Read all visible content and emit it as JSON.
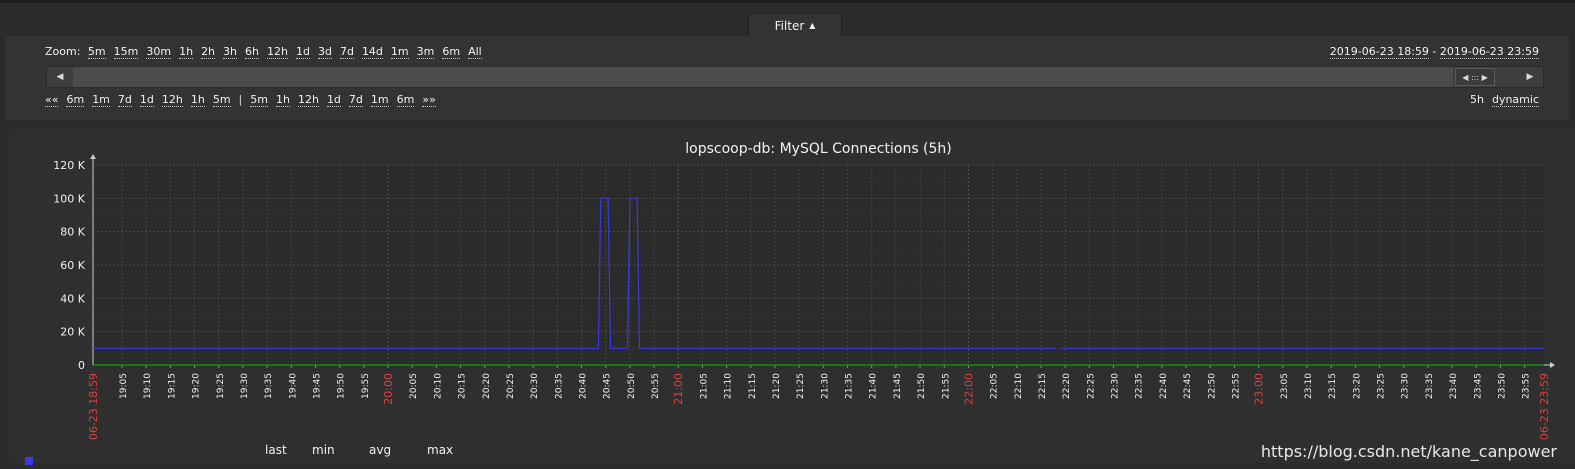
{
  "filter": {
    "label": "Filter",
    "arrow": "▲"
  },
  "zoom": {
    "label": "Zoom:",
    "options": [
      "5m",
      "15m",
      "30m",
      "1h",
      "2h",
      "3h",
      "6h",
      "12h",
      "1d",
      "3d",
      "7d",
      "14d",
      "1m",
      "3m",
      "6m",
      "All"
    ]
  },
  "range": {
    "from": "2019-06-23 18:59",
    "dash": " - ",
    "to": "2019-06-23 23:59"
  },
  "nav": {
    "back_all": "««",
    "back": [
      "6m",
      "1m",
      "7d",
      "1d",
      "12h",
      "1h",
      "5m"
    ],
    "sep": "|",
    "forward": [
      "5m",
      "1h",
      "12h",
      "1d",
      "7d",
      "1m",
      "6m"
    ],
    "forward_all": "»»"
  },
  "period": {
    "length": "5h",
    "mode": "dynamic"
  },
  "slider": {
    "left_icon": "◀",
    "right_icon": "▶",
    "handle": "◀ ::: ▶"
  },
  "chart_data": {
    "type": "line",
    "title": "lopscoop-db: MySQL Connections (5h)",
    "y_ticks": [
      "120 K",
      "100 K",
      "80 K",
      "60 K",
      "40 K",
      "20 K",
      "0"
    ],
    "ylim": [
      0,
      120000
    ],
    "x_start_label": "06-23 18:59",
    "x_end_label": "06-23 23:59",
    "x_ticks": [
      "19:05",
      "19:10",
      "19:15",
      "19:20",
      "19:25",
      "19:30",
      "19:35",
      "19:40",
      "19:45",
      "19:50",
      "19:55",
      "20:00",
      "20:05",
      "20:10",
      "20:15",
      "20:20",
      "20:25",
      "20:30",
      "20:35",
      "20:40",
      "20:45",
      "20:50",
      "20:55",
      "21:00",
      "21:05",
      "21:10",
      "21:15",
      "21:20",
      "21:25",
      "21:30",
      "21:35",
      "21:40",
      "21:45",
      "21:50",
      "21:55",
      "22:00",
      "22:05",
      "22:10",
      "22:15",
      "22:20",
      "22:25",
      "22:30",
      "22:35",
      "22:40",
      "22:45",
      "22:50",
      "22:55",
      "23:00",
      "23:05",
      "23:10",
      "23:15",
      "23:20",
      "23:25",
      "23:30",
      "23:35",
      "23:40",
      "23:45",
      "23:50",
      "23:55"
    ],
    "hour_ticks": [
      "20:00",
      "21:00",
      "22:00",
      "23:00"
    ],
    "grid": true,
    "series": [
      {
        "color": "#3a3ae0",
        "segments": [
          {
            "x": [
              "18:59",
              "20:43.5",
              "20:44",
              "20:45.5",
              "20:46",
              "20:49.5",
              "20:50",
              "20:51.5",
              "20:52",
              "22:18"
            ],
            "y": [
              10000,
              10000,
              100000,
              100000,
              10000,
              10000,
              100000,
              100000,
              10000,
              10000
            ]
          },
          {
            "x": [
              "22:19",
              "23:59"
            ],
            "y": [
              10000,
              10000
            ]
          }
        ]
      },
      {
        "color": "#00aa00",
        "segments": [
          {
            "x": [
              "18:59",
              "23:59"
            ],
            "y": [
              0,
              0
            ]
          }
        ]
      }
    ],
    "legend_columns": [
      "last",
      "min",
      "avg",
      "max"
    ]
  },
  "watermark": "https://blog.csdn.net/kane_canpower"
}
